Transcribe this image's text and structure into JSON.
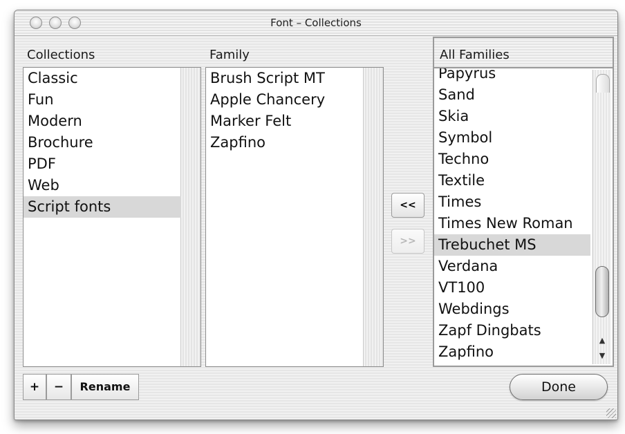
{
  "window": {
    "title": "Font – Collections"
  },
  "headers": {
    "collections": "Collections",
    "family": "Family",
    "all_families": "All Families"
  },
  "collections": {
    "items": [
      "Classic",
      "Fun",
      "Modern",
      "Brochure",
      "PDF",
      "Web",
      "Script fonts"
    ],
    "selected_index": 6
  },
  "family": {
    "items": [
      "Brush Script MT",
      "Apple Chancery",
      "Marker Felt",
      "Zapfino"
    ]
  },
  "all_families": {
    "items": [
      "Papyrus",
      "Sand",
      "Skia",
      "Symbol",
      "Techno",
      "Textile",
      "Times",
      "Times New Roman",
      "Trebuchet MS",
      "Verdana",
      "VT100",
      "Webdings",
      "Zapf Dingbats",
      "Zapfino"
    ],
    "selected_index": 8
  },
  "buttons": {
    "add_to_collection": "<<",
    "remove_from_collection": ">>",
    "plus": "+",
    "minus": "−",
    "rename": "Rename",
    "done": "Done"
  },
  "icons": {
    "close": "close-button-icon",
    "minimize": "minimize-button-icon",
    "zoom": "zoom-button-icon",
    "scroll_up": "scroll-up-arrow-icon",
    "scroll_down": "scroll-down-arrow-icon",
    "resize": "resize-grip-icon"
  }
}
